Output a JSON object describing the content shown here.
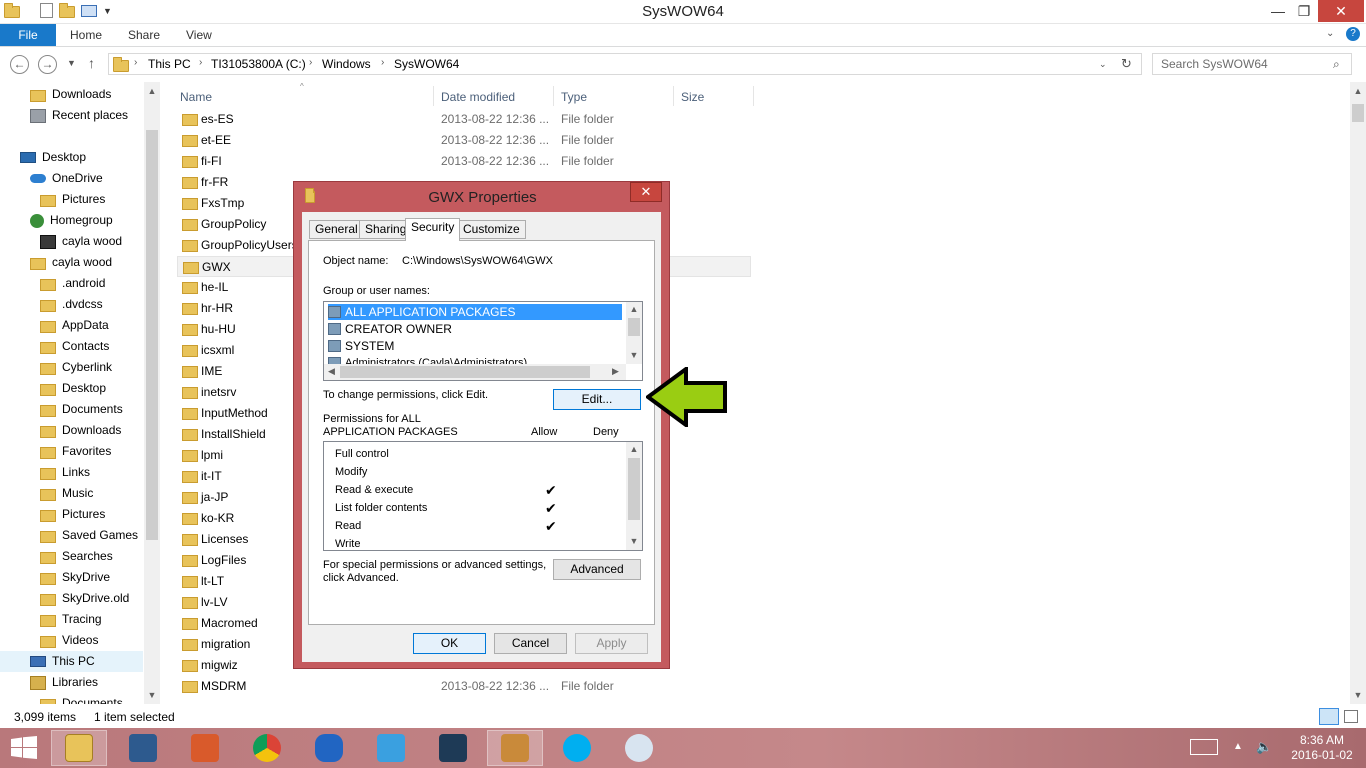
{
  "window": {
    "title": "SysWOW64"
  },
  "ribbon": {
    "tabs": [
      "File",
      "Home",
      "Share",
      "View"
    ]
  },
  "address": {
    "crumbs": [
      "This PC",
      "TI31053800A (C:)",
      "Windows",
      "SysWOW64"
    ],
    "search_placeholder": "Search SysWOW64"
  },
  "nav": {
    "items": [
      {
        "label": "Downloads",
        "icon": "folder-icon"
      },
      {
        "label": "Recent places",
        "icon": "recent-places-icon"
      },
      {
        "label": "Desktop",
        "icon": "desktop-icon"
      },
      {
        "label": "OneDrive",
        "icon": "onedrive-icon"
      },
      {
        "label": "Pictures",
        "icon": "folder-icon"
      },
      {
        "label": "Homegroup",
        "icon": "homegroup-icon"
      },
      {
        "label": "cayla wood",
        "icon": "user-avatar-icon"
      },
      {
        "label": "cayla wood",
        "icon": "user-folder-icon"
      },
      {
        "label": ".android",
        "icon": "folder-icon"
      },
      {
        "label": ".dvdcss",
        "icon": "folder-icon"
      },
      {
        "label": "AppData",
        "icon": "folder-icon"
      },
      {
        "label": "Contacts",
        "icon": "folder-icon"
      },
      {
        "label": "Cyberlink",
        "icon": "folder-icon"
      },
      {
        "label": "Desktop",
        "icon": "folder-icon"
      },
      {
        "label": "Documents",
        "icon": "folder-icon"
      },
      {
        "label": "Downloads",
        "icon": "folder-icon"
      },
      {
        "label": "Favorites",
        "icon": "folder-icon"
      },
      {
        "label": "Links",
        "icon": "folder-icon"
      },
      {
        "label": "Music",
        "icon": "folder-icon"
      },
      {
        "label": "Pictures",
        "icon": "folder-icon"
      },
      {
        "label": "Saved Games",
        "icon": "folder-icon"
      },
      {
        "label": "Searches",
        "icon": "folder-icon"
      },
      {
        "label": "SkyDrive",
        "icon": "folder-icon"
      },
      {
        "label": "SkyDrive.old",
        "icon": "folder-icon"
      },
      {
        "label": "Tracing",
        "icon": "folder-icon"
      },
      {
        "label": "Videos",
        "icon": "folder-icon"
      },
      {
        "label": "This PC",
        "icon": "this-pc-icon"
      },
      {
        "label": "Libraries",
        "icon": "libraries-icon"
      },
      {
        "label": "Documents",
        "icon": "folder-icon"
      }
    ]
  },
  "columns": {
    "name": "Name",
    "date": "Date modified",
    "type": "Type",
    "size": "Size"
  },
  "files": [
    {
      "name": "es-ES",
      "date": "2013-08-22 12:36 ...",
      "type": "File folder"
    },
    {
      "name": "et-EE",
      "date": "2013-08-22 12:36 ...",
      "type": "File folder"
    },
    {
      "name": "fi-FI",
      "date": "2013-08-22 12:36 ...",
      "type": "File folder"
    },
    {
      "name": "fr-FR",
      "date": "",
      "type": ""
    },
    {
      "name": "FxsTmp",
      "date": "",
      "type": ""
    },
    {
      "name": "GroupPolicy",
      "date": "",
      "type": ""
    },
    {
      "name": "GroupPolicyUsers",
      "date": "",
      "type": ""
    },
    {
      "name": "GWX",
      "date": "",
      "type": ""
    },
    {
      "name": "he-IL",
      "date": "",
      "type": ""
    },
    {
      "name": "hr-HR",
      "date": "",
      "type": ""
    },
    {
      "name": "hu-HU",
      "date": "",
      "type": ""
    },
    {
      "name": "icsxml",
      "date": "",
      "type": ""
    },
    {
      "name": "IME",
      "date": "",
      "type": ""
    },
    {
      "name": "inetsrv",
      "date": "",
      "type": ""
    },
    {
      "name": "InputMethod",
      "date": "",
      "type": ""
    },
    {
      "name": "InstallShield",
      "date": "",
      "type": ""
    },
    {
      "name": "lpmi",
      "date": "",
      "type": ""
    },
    {
      "name": "it-IT",
      "date": "",
      "type": ""
    },
    {
      "name": "ja-JP",
      "date": "",
      "type": ""
    },
    {
      "name": "ko-KR",
      "date": "",
      "type": ""
    },
    {
      "name": "Licenses",
      "date": "",
      "type": ""
    },
    {
      "name": "LogFiles",
      "date": "",
      "type": ""
    },
    {
      "name": "lt-LT",
      "date": "",
      "type": ""
    },
    {
      "name": "lv-LV",
      "date": "",
      "type": ""
    },
    {
      "name": "Macromed",
      "date": "",
      "type": ""
    },
    {
      "name": "migration",
      "date": "",
      "type": ""
    },
    {
      "name": "migwiz",
      "date": "",
      "type": ""
    },
    {
      "name": "MSDRM",
      "date": "2013-08-22 12:36 ...",
      "type": "File folder"
    }
  ],
  "status": {
    "count": "3,099 items",
    "selected": "1 item selected"
  },
  "dialog": {
    "title": "GWX Properties",
    "tabs": [
      "General",
      "Sharing",
      "Security",
      "Customize"
    ],
    "object_label": "Object name:",
    "object_value": "C:\\Windows\\SysWOW64\\GWX",
    "group_label": "Group or user names:",
    "groups": [
      "ALL APPLICATION PACKAGES",
      "CREATOR OWNER",
      "SYSTEM",
      "Administrators (Cayla\\Administrators)"
    ],
    "change_text": "To change permissions, click Edit.",
    "edit_label": "Edit...",
    "perm_label_1": "Permissions for ALL",
    "perm_label_2": "APPLICATION PACKAGES",
    "allow": "Allow",
    "deny": "Deny",
    "permissions": [
      {
        "name": "Full control",
        "allow": ""
      },
      {
        "name": "Modify",
        "allow": ""
      },
      {
        "name": "Read & execute",
        "allow": "✔"
      },
      {
        "name": "List folder contents",
        "allow": "✔"
      },
      {
        "name": "Read",
        "allow": "✔"
      },
      {
        "name": "Write",
        "allow": ""
      }
    ],
    "special_1": "For special permissions or advanced settings,",
    "special_2": "click Advanced.",
    "advanced_label": "Advanced",
    "ok": "OK",
    "cancel": "Cancel",
    "apply": "Apply"
  },
  "taskbar": {
    "time": "8:36 AM",
    "date": "2016-01-02"
  },
  "colors": {
    "accent": "#1979ca",
    "dialog_frame": "#c45a5e",
    "arrow_fill": "#9acd12",
    "selection": "#3399ff"
  }
}
